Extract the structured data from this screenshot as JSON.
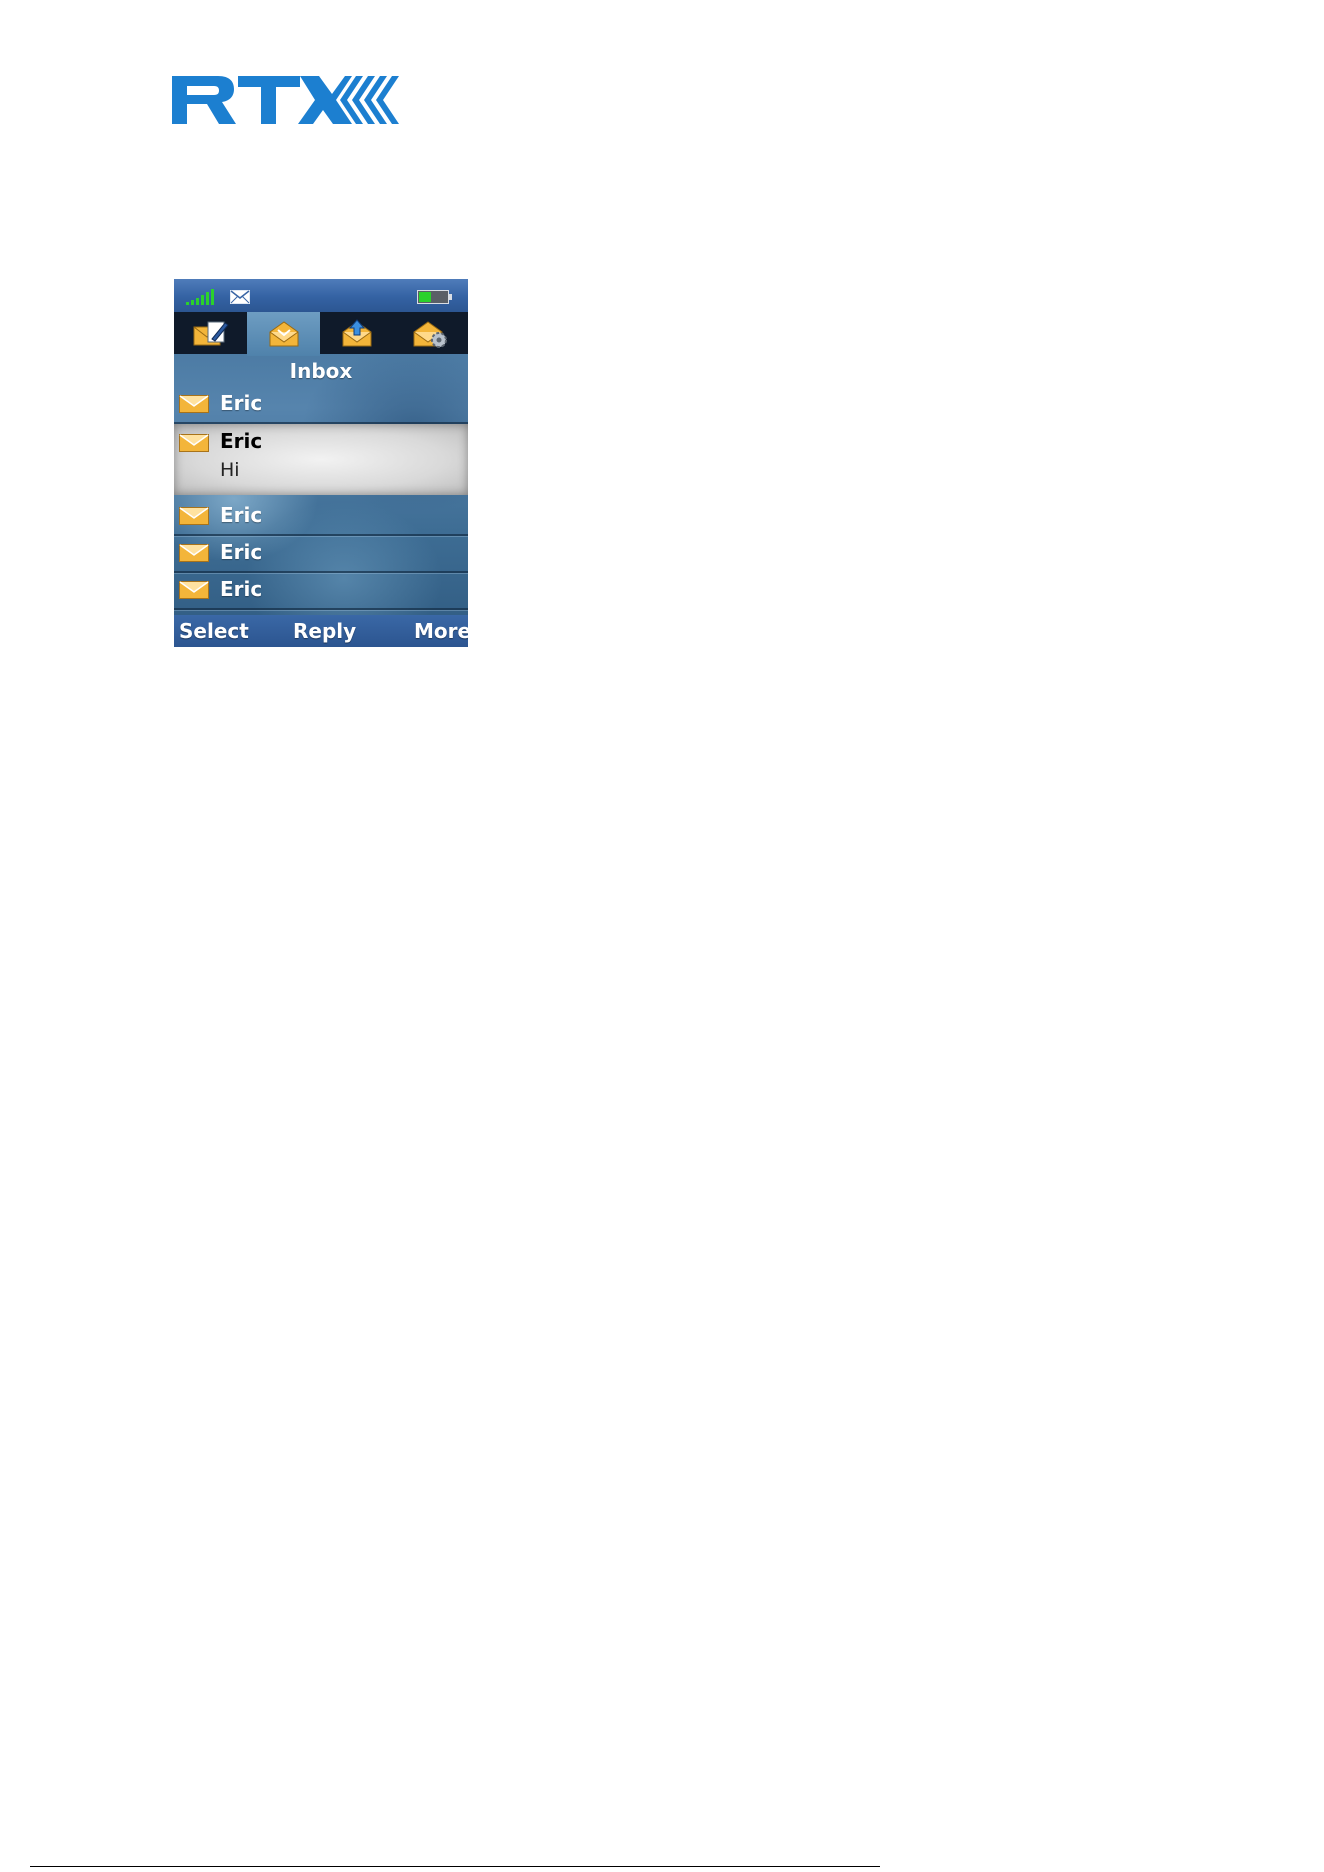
{
  "brand": {
    "logo_text": "RTX"
  },
  "phone": {
    "status": {
      "signal_icon": "signal-bars-icon",
      "message_icon": "envelope-icon",
      "battery_icon": "battery-icon"
    },
    "tabs": [
      {
        "icon": "compose-message-icon",
        "active": false
      },
      {
        "icon": "inbox-icon",
        "active": true
      },
      {
        "icon": "outbox-icon",
        "active": false
      },
      {
        "icon": "message-settings-icon",
        "active": false
      }
    ],
    "title": "Inbox",
    "messages": [
      {
        "sender": "Eric"
      },
      {
        "sender": "Eric",
        "preview": "Hi",
        "selected": true
      },
      {
        "sender": "Eric"
      },
      {
        "sender": "Eric"
      },
      {
        "sender": "Eric"
      }
    ],
    "softkeys": {
      "left": "Select",
      "center": "Reply",
      "right": "More"
    }
  },
  "colors": {
    "logo_blue": "#1c7fd0",
    "envelope": "#f3b53a",
    "signal_green": "#2bd12b"
  }
}
